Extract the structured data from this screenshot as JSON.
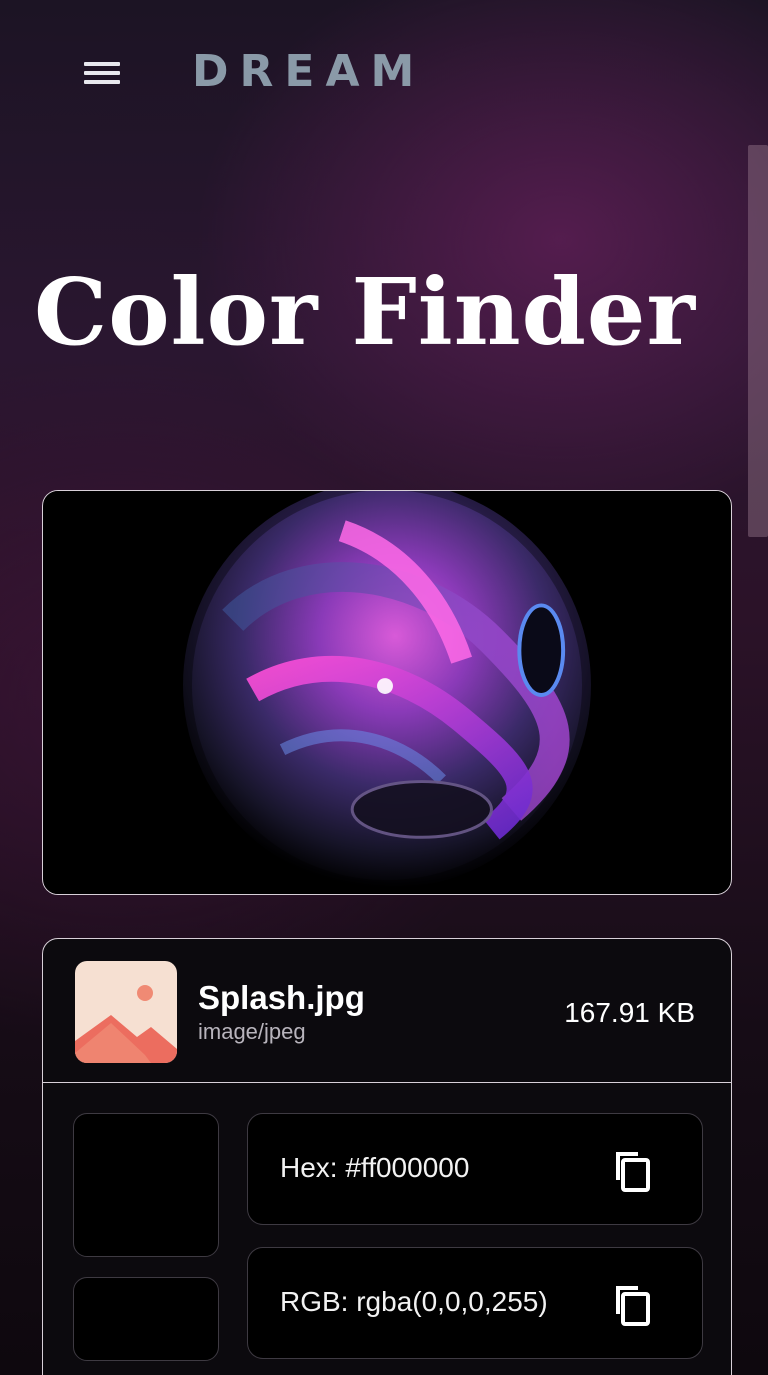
{
  "header": {
    "brand": "DREAM",
    "menu_icon": "hamburger-menu-icon"
  },
  "page": {
    "title": "Color Finder"
  },
  "preview": {
    "image_description_icon": "abstract-sphere-image"
  },
  "file": {
    "name": "Splash.jpg",
    "type": "image/jpeg",
    "size": "167.91 KB",
    "thumbnail_icon": "image-file-icon"
  },
  "color": {
    "hex_label": "Hex: #ff000000",
    "rgb_label": "RGB: rgba(0,0,0,255)",
    "swatch_color": "#000000",
    "copy_icon": "copy-icon"
  },
  "colors": {
    "brand_text": "#8a9aa8",
    "thumb_bg": "#f6e0d2",
    "thumb_mountain": "#ec6d5f",
    "thumb_sun": "#f08a74"
  }
}
